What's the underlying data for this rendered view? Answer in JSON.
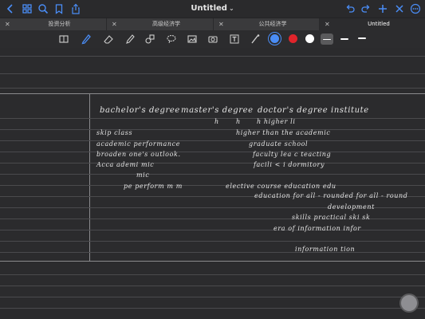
{
  "header": {
    "title": "Untitled",
    "icons": [
      "chevron-left-icon",
      "grid-icon",
      "search-icon",
      "bookmark-icon",
      "share-icon",
      "undo-icon",
      "redo-icon",
      "plus-icon",
      "close-icon",
      "more-icon"
    ]
  },
  "tabs": [
    {
      "label": "投资分析",
      "active": false
    },
    {
      "label": "高级经济学",
      "active": false
    },
    {
      "label": "公共经济学",
      "active": false
    },
    {
      "label": "Untitled",
      "active": true
    }
  ],
  "toolbar": {
    "colors": [
      "#4a8df6",
      "#e0242b",
      "#ffffff"
    ],
    "selected_color": "#4a8df6"
  },
  "notes": [
    {
      "text": "bachelor's  degree",
      "size": "big"
    },
    {
      "text": "master's  degree",
      "size": "big"
    },
    {
      "text": "doctor's  degree  institute",
      "size": "big"
    },
    {
      "text": "h",
      "size": "sm"
    },
    {
      "text": "h",
      "size": "sm"
    },
    {
      "text": "h  higher  li",
      "size": "sm"
    },
    {
      "text": "skip  class",
      "size": "sm"
    },
    {
      "text": "higher  than   the  academic",
      "size": "sm"
    },
    {
      "text": "academic  performance",
      "size": "sm"
    },
    {
      "text": "graduate  school",
      "size": "sm"
    },
    {
      "text": "broaden  one's  outlook.",
      "size": "sm"
    },
    {
      "text": "faculty  lea  c teacting",
      "size": "sm"
    },
    {
      "text": "Acca    ademi  mic",
      "size": "sm"
    },
    {
      "text": "facili   <  i     dormitory",
      "size": "sm"
    },
    {
      "text": "mic",
      "size": "sm"
    },
    {
      "text": "pe     perform  m m",
      "size": "sm"
    },
    {
      "text": "elective   course    education    edu",
      "size": "sm"
    },
    {
      "text": "education   for   all - rounded  for  all - round",
      "size": "sm"
    },
    {
      "text": "development",
      "size": "sm"
    },
    {
      "text": "skills        practical  ski   sk",
      "size": "sm"
    },
    {
      "text": "era  of  information    infor",
      "size": "sm"
    },
    {
      "text": "information  tion",
      "size": "sm"
    }
  ]
}
